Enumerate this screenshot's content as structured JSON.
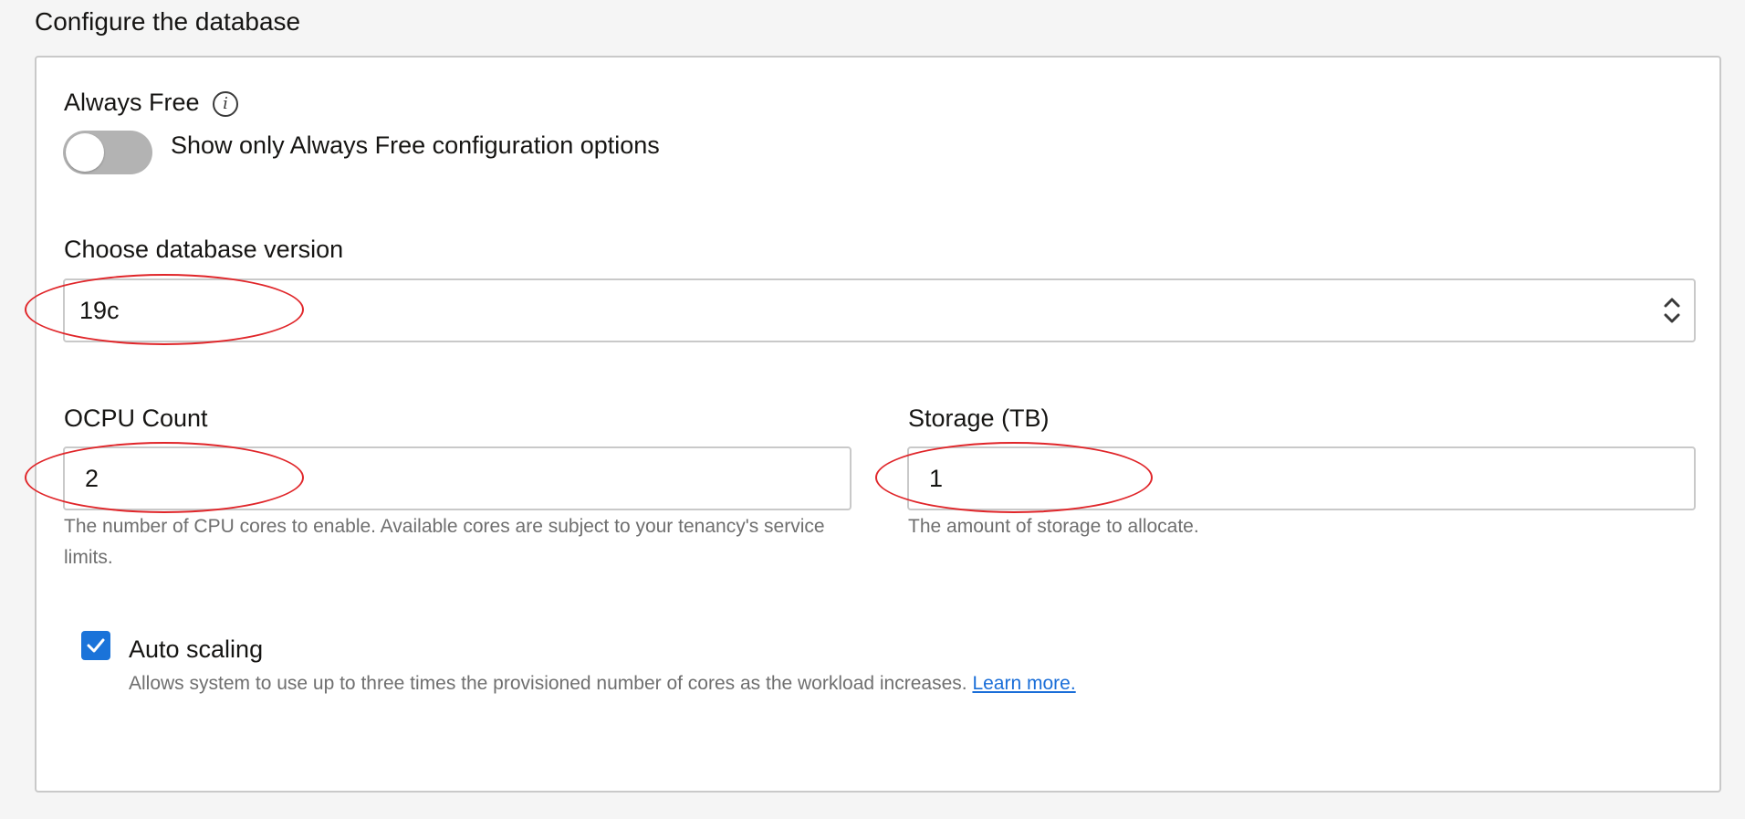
{
  "section_title": "Configure the database",
  "always_free": {
    "label": "Always Free",
    "info_icon": "info-icon",
    "info_glyph": "i",
    "toggle_on": false,
    "toggle_text": "Show only Always Free configuration options"
  },
  "version": {
    "label": "Choose database version",
    "selected": "19c",
    "arrows_icon": "up-down-chevron-icon"
  },
  "ocpu": {
    "label": "OCPU Count",
    "value": "2",
    "help": "The number of CPU cores to enable. Available cores are subject to your tenancy's service limits."
  },
  "storage": {
    "label": "Storage (TB)",
    "value": "1",
    "help": "The amount of storage to allocate."
  },
  "auto_scaling": {
    "checked": true,
    "label": "Auto scaling",
    "help": "Allows system to use up to three times the provisioned number of cores as the workload increases.",
    "link": "Learn more."
  },
  "colors": {
    "accent": "#1a73d9",
    "link": "#1a6ed8",
    "annotation": "#e0262a",
    "toggle_off": "#b3b3b3"
  }
}
